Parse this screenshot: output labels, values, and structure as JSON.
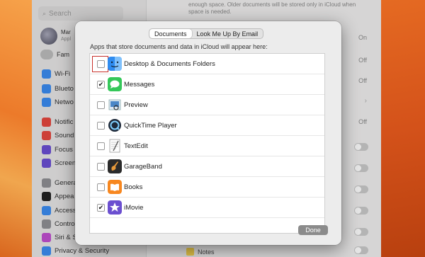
{
  "colors": {
    "accent": "#3a7bd5",
    "focus_ring": "#c8302a",
    "done_button": "#8b8b8b"
  },
  "sidebar": {
    "search_placeholder": "Search",
    "account_name": "Mar",
    "account_sub": "Appl",
    "family_label": "Fam",
    "items": [
      {
        "label": "Wi-Fi",
        "icon": "wifi-icon",
        "color": "#3b8cf0"
      },
      {
        "label": "Blueto",
        "icon": "bluetooth-icon",
        "color": "#3b8cf0"
      },
      {
        "label": "Netwo",
        "icon": "network-icon",
        "color": "#3b8cf0"
      },
      {
        "label": "Notific",
        "icon": "notifications-icon",
        "color": "#e5483f"
      },
      {
        "label": "Sound",
        "icon": "sound-icon",
        "color": "#e5483f"
      },
      {
        "label": "Focus",
        "icon": "focus-icon",
        "color": "#6a4fd3"
      },
      {
        "label": "Screen",
        "icon": "screen-time-icon",
        "color": "#6a4fd3"
      },
      {
        "label": "Genera",
        "icon": "general-icon",
        "color": "#8f8f94"
      },
      {
        "label": "Appea",
        "icon": "appearance-icon",
        "color": "#222"
      },
      {
        "label": "Access",
        "icon": "accessibility-icon",
        "color": "#3b8cf0"
      },
      {
        "label": "Contro",
        "icon": "control-centre-icon",
        "color": "#8f8f94"
      },
      {
        "label": "Siri & S",
        "icon": "siri-icon",
        "color": "#c04fd0"
      },
      {
        "label": "Privacy & Security",
        "icon": "privacy-icon",
        "color": "#3b8cf0"
      }
    ]
  },
  "main": {
    "top_note": "enough space. Older documents will be stored only in iCloud when space is needed.",
    "values": [
      "On",
      "Off",
      "Off",
      "Off"
    ],
    "notes_label": "Notes"
  },
  "sheet": {
    "tabs": [
      {
        "label": "Documents"
      },
      {
        "label": "Look Me Up By Email"
      }
    ],
    "description": "Apps that store documents and data in iCloud will appear here:",
    "apps": [
      {
        "name": "Desktop & Documents Folders",
        "checked": false,
        "icon": "finder-icon",
        "mark": ""
      },
      {
        "name": "Messages",
        "checked": true,
        "icon": "messages-icon",
        "mark": "✔"
      },
      {
        "name": "Preview",
        "checked": false,
        "icon": "preview-icon",
        "mark": ""
      },
      {
        "name": "QuickTime Player",
        "checked": false,
        "icon": "quicktime-icon",
        "mark": ""
      },
      {
        "name": "TextEdit",
        "checked": false,
        "icon": "textedit-icon",
        "mark": ""
      },
      {
        "name": "GarageBand",
        "checked": false,
        "icon": "garageband-icon",
        "mark": ""
      },
      {
        "name": "Books",
        "checked": false,
        "icon": "books-icon",
        "mark": ""
      },
      {
        "name": "iMovie",
        "checked": true,
        "icon": "imovie-icon",
        "mark": "✔"
      }
    ],
    "done_label": "Done"
  }
}
